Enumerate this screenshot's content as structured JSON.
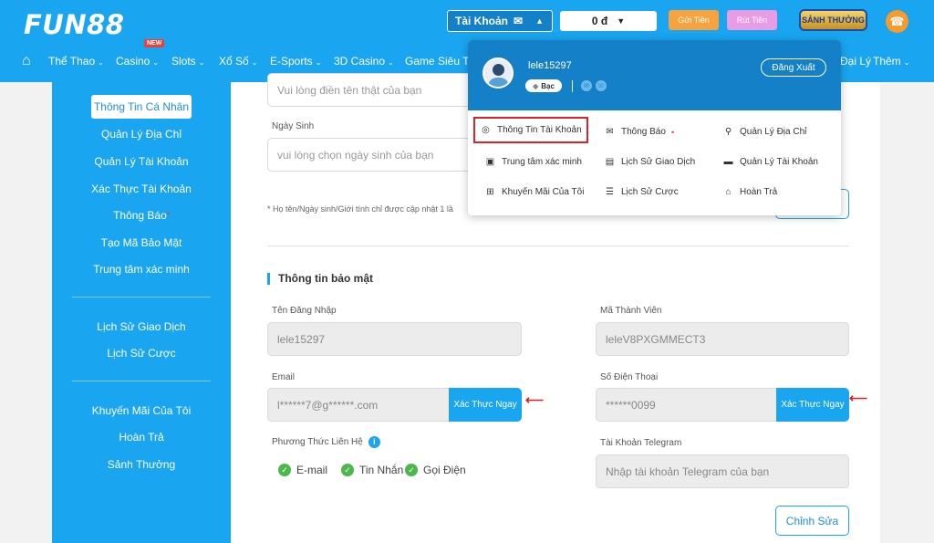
{
  "header": {
    "logo": "FUN88",
    "account_label": "Tài Khoản",
    "balance": "0 đ",
    "deposit": "Gửi Tiền",
    "withdraw": "Rút Tiền",
    "reward": "SẢNH THƯỞNG",
    "new_badge": "NEW"
  },
  "nav": [
    {
      "label": "Thể Thao"
    },
    {
      "label": "Casino"
    },
    {
      "label": "Slots"
    },
    {
      "label": "Xổ Số"
    },
    {
      "label": "E-Sports"
    },
    {
      "label": "3D Casino"
    },
    {
      "label": "Game Siêu Tố"
    },
    {
      "label": "Đại Lý"
    },
    {
      "label": "Thêm"
    }
  ],
  "sidebar": {
    "items": [
      {
        "label": "Thông Tin Cá Nhân"
      },
      {
        "label": "Quản Lý Địa Chỉ"
      },
      {
        "label": "Quản Lý Tài Khoản"
      },
      {
        "label": "Xác Thực Tài Khoản"
      },
      {
        "label": "Thông Báo"
      },
      {
        "label": "Tạo Mã Bảo Mật"
      },
      {
        "label": "Trung tâm xác minh"
      },
      {
        "label": "Lịch Sử Giao Dịch"
      },
      {
        "label": "Lịch Sử Cược"
      },
      {
        "label": "Khuyến Mãi Của Tôi"
      },
      {
        "label": "Hoàn Trả"
      },
      {
        "label": "Sảnh Thưởng"
      }
    ]
  },
  "form": {
    "realname_placeholder": "Vui lòng điền tên thật của bạn",
    "birthday_label": "Ngày Sinh",
    "birthday_placeholder": "vui lòng chọn ngày sinh của bạn",
    "note": "* Họ tên/Ngày sinh/Giới tính chỉ được cập nhật 1 lầ",
    "security_title": "Thông tin bảo mật",
    "username_label": "Tên Đăng Nhập",
    "username_value": "lele15297",
    "member_code_label": "Mã Thành Viên",
    "member_code_value": "leleV8PXGMMECT3",
    "email_label": "Email",
    "email_value": "l******7@g******.com",
    "phone_label": "Số Điện Thoại",
    "phone_value": "******0099",
    "verify_label": "Xác Thực Ngay",
    "contact_label": "Phương Thức Liên Hệ",
    "contact_options": [
      {
        "label": "E-mail"
      },
      {
        "label": "Tin Nhắn"
      },
      {
        "label": "Gọi Điện"
      }
    ],
    "telegram_label": "Tài Khoản Telegram",
    "telegram_placeholder": "Nhập tài khoản Telegram của bạn",
    "edit_button": "Chỉnh Sửa"
  },
  "dropdown": {
    "username": "lele15297",
    "tier": "Bạc",
    "logout": "Đăng Xuất",
    "items": [
      {
        "label": "Thông Tin Tài Khoản",
        "icon": "user-circle-icon"
      },
      {
        "label": "Thông Báo",
        "icon": "mail-icon"
      },
      {
        "label": "Quản Lý Địa Chỉ",
        "icon": "location-pin-icon"
      },
      {
        "label": "Trung tâm xác minh",
        "icon": "verify-screen-icon"
      },
      {
        "label": "Lịch Sử Giao Dịch",
        "icon": "document-icon"
      },
      {
        "label": "Quản Lý Tài Khoản",
        "icon": "card-icon"
      },
      {
        "label": "Khuyến Mãi Của Tôi",
        "icon": "gift-icon"
      },
      {
        "label": "Lịch Sử Cược",
        "icon": "list-icon"
      },
      {
        "label": "Hoàn Trả",
        "icon": "bank-icon"
      }
    ]
  },
  "colors": {
    "brand_blue": "#1aa5f0",
    "dark_blue": "#1480c8",
    "highlight_red": "#d9232a",
    "check_green": "#4cb84c"
  }
}
